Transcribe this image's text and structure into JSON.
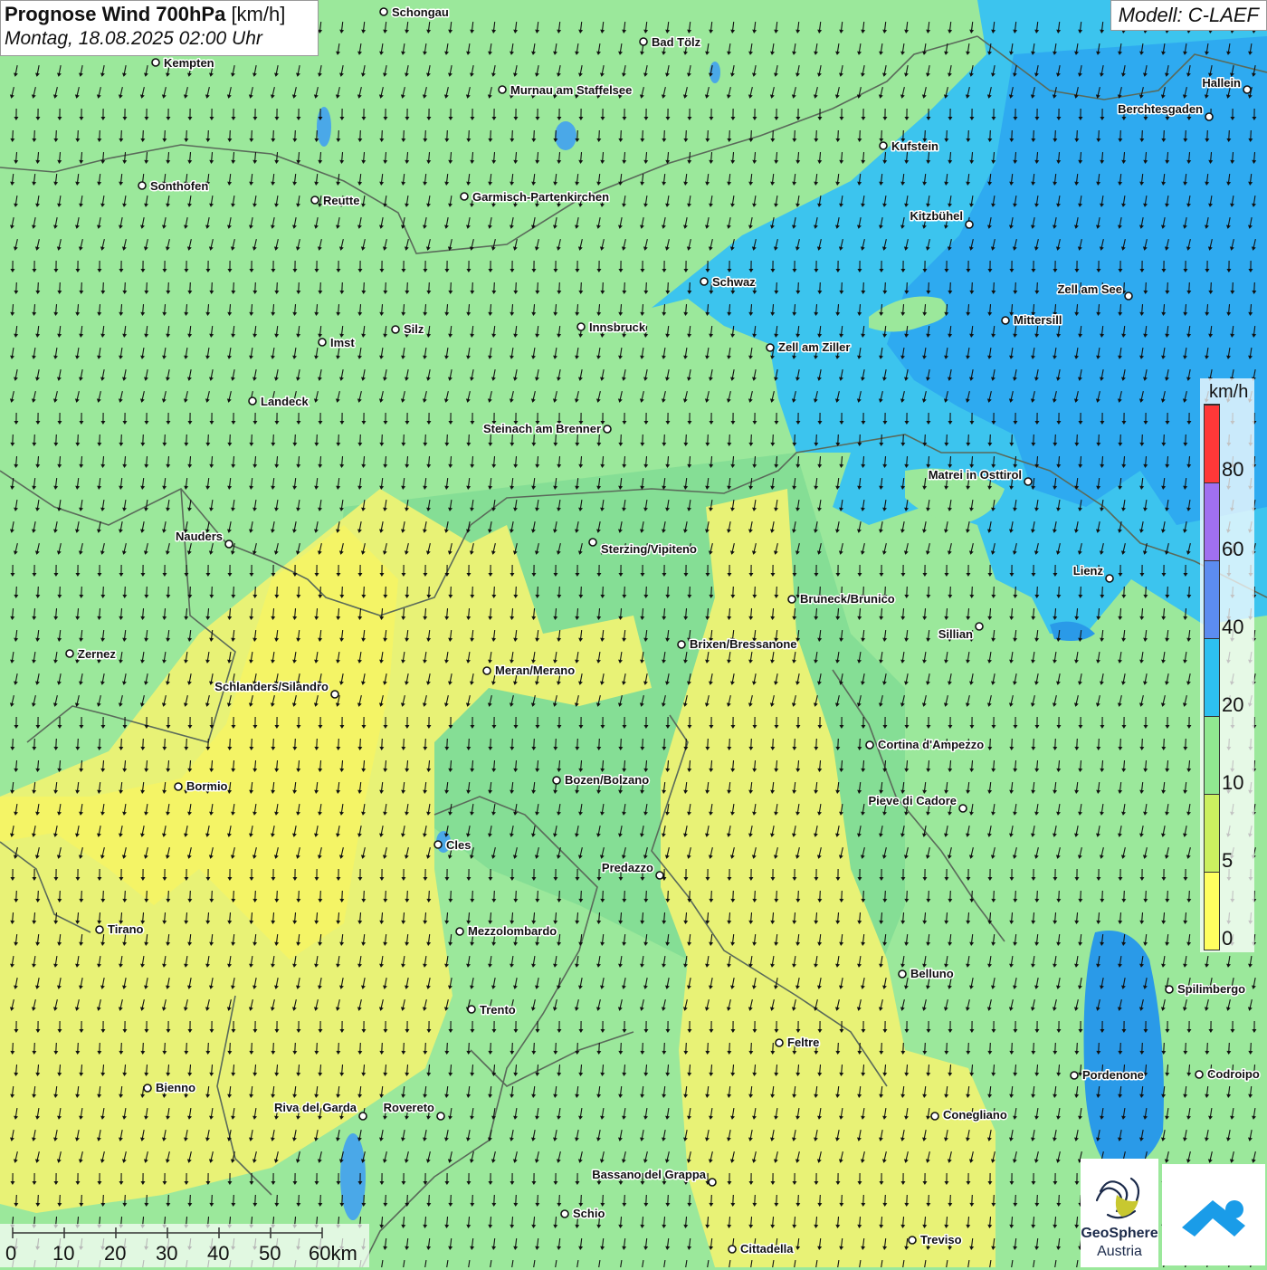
{
  "title": {
    "main": "Prognose Wind 700hPa",
    "unit": "[km/h]",
    "datetime": "Montag, 18.08.2025 02:00 Uhr"
  },
  "model": "Modell: C-LAEF",
  "legend": {
    "unit": "km/h",
    "ticks": [
      "80",
      "60",
      "40",
      "20",
      "10",
      "5",
      "0"
    ],
    "colors": [
      "#ff3838",
      "#a070f0",
      "#5c8cf0",
      "#2dc0f0",
      "#90e890",
      "#ccf060",
      "#ffff60"
    ]
  },
  "scale": {
    "labels": [
      "0",
      "10",
      "20",
      "30",
      "40",
      "50",
      "60km"
    ]
  },
  "logos": {
    "geosphere_name": "GeoSphere",
    "geosphere_sub": "Austria"
  },
  "colors": {
    "calm_yellow": "#f0f070",
    "light_green": "#9be89b",
    "mid_green": "#80dc90",
    "cyan": "#3cc4ee",
    "blue": "#2eaaf0",
    "lake_blue": "#2a9ae8",
    "border": "#5a6a5a"
  },
  "cities": [
    {
      "name": "Schongau"
    },
    {
      "name": "Bad Tölz"
    },
    {
      "name": "Kempten"
    },
    {
      "name": "Murnau am Staffelsee"
    },
    {
      "name": "Hallein"
    },
    {
      "name": "Berchtesgaden"
    },
    {
      "name": "Kufstein"
    },
    {
      "name": "Sonthofen"
    },
    {
      "name": "Reutte"
    },
    {
      "name": "Garmisch-Partenkirchen"
    },
    {
      "name": "Kitzbühel"
    },
    {
      "name": "Schwaz"
    },
    {
      "name": "Zell am See"
    },
    {
      "name": "Mittersill"
    },
    {
      "name": "Innsbruck"
    },
    {
      "name": "Silz"
    },
    {
      "name": "Imst"
    },
    {
      "name": "Zell am Ziller"
    },
    {
      "name": "Landeck"
    },
    {
      "name": "Steinach am Brenner"
    },
    {
      "name": "Matrei in Osttirol"
    },
    {
      "name": "Nauders"
    },
    {
      "name": "Sterzing/Vipiteno"
    },
    {
      "name": "Lienz"
    },
    {
      "name": "Bruneck/Brunico"
    },
    {
      "name": "Sillian"
    },
    {
      "name": "Zernez"
    },
    {
      "name": "Brixen/Bressanone"
    },
    {
      "name": "Meran/Merano"
    },
    {
      "name": "Schlanders/Silandro"
    },
    {
      "name": "Cortina d'Ampezzo"
    },
    {
      "name": "Bozen/Bolzano"
    },
    {
      "name": "Bormio"
    },
    {
      "name": "Pieve di Cadore"
    },
    {
      "name": "Cles"
    },
    {
      "name": "Predazzo"
    },
    {
      "name": "Tirano"
    },
    {
      "name": "Mezzolombardo"
    },
    {
      "name": "Belluno"
    },
    {
      "name": "Spilimbergo"
    },
    {
      "name": "Trento"
    },
    {
      "name": "Feltre"
    },
    {
      "name": "Bienno"
    },
    {
      "name": "Pordenone"
    },
    {
      "name": "Codroipo"
    },
    {
      "name": "Riva del Garda"
    },
    {
      "name": "Rovereto"
    },
    {
      "name": "Conegliano"
    },
    {
      "name": "Bassano del Grappa"
    },
    {
      "name": "Schio"
    },
    {
      "name": "Treviso"
    },
    {
      "name": "Cittadella"
    }
  ]
}
